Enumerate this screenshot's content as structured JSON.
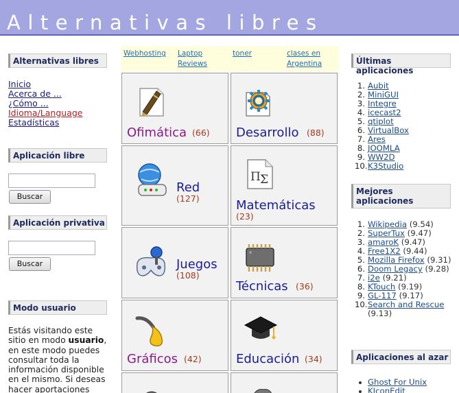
{
  "header": {
    "title": "Alternativas libres"
  },
  "left": {
    "nav_header": "Alternativas libres",
    "nav": [
      "Inicio",
      "Acerca de ...",
      "¿Cómo ...",
      "Idioma/Language",
      "Estadísticas"
    ],
    "free_app": {
      "header": "Aplicación libre",
      "input_value": "",
      "button": "Buscar"
    },
    "priv_app": {
      "header": "Aplicación privativa",
      "input_value": "",
      "button": "Buscar"
    },
    "mode": {
      "header": "Modo usuario",
      "text_before": "Estás visitando este sitio en modo ",
      "text_bold": "usuario",
      "text_after": ", en este modo puedes consultar toda la información disponible en el mismo. Si deseas hacer aportaciones"
    }
  },
  "ads": [
    "Webhosting",
    "Laptop Reviews",
    "toner",
    "clases en Argentina"
  ],
  "categories": [
    {
      "name": "Ofimática",
      "count": "(66)",
      "icon": "pen-document-icon",
      "color": "#8b1a8b"
    },
    {
      "name": "Desarrollo",
      "count": "(88)",
      "icon": "gear-document-icon",
      "color": "#1a1a9c"
    },
    {
      "name": "Red",
      "count": "(127)",
      "icon": "network-router-icon",
      "color": "#1a1a9c"
    },
    {
      "name": "Matemáticas",
      "count": "(23)",
      "icon": "math-formula-icon",
      "color": "#1a1a9c"
    },
    {
      "name": "Juegos",
      "count": "(108)",
      "icon": "gamepad-icon",
      "color": "#1a1a9c"
    },
    {
      "name": "Técnicas",
      "count": "(36)",
      "icon": "microchip-icon",
      "color": "#1a1a9c"
    },
    {
      "name": "Gráficos",
      "count": "(42)",
      "icon": "paintbrush-icon",
      "color": "#8b1a8b"
    },
    {
      "name": "Educación",
      "count": "(34)",
      "icon": "graduation-cap-icon",
      "color": "#1a1a9c"
    }
  ],
  "right": {
    "latest": {
      "header": "Últimas aplicaciones",
      "items": [
        "Aubit",
        "MiniGUI",
        "Integre",
        "icecast2",
        "qtiplot",
        "VirtualBox",
        "Ares",
        "JOOMLA",
        "WW2D",
        "K3Studio"
      ]
    },
    "best": {
      "header": "Mejores aplicaciones",
      "items": [
        {
          "name": "Wikipedia",
          "score": "(9.54)"
        },
        {
          "name": "SuperTux",
          "score": "(9.47)"
        },
        {
          "name": "amaroK",
          "score": "(9.47)"
        },
        {
          "name": "Free1X2",
          "score": "(9.44)"
        },
        {
          "name": "Mozilla Firefox",
          "score": "(9.31)"
        },
        {
          "name": "Doom Legacy",
          "score": "(9.28)"
        },
        {
          "name": "i2e",
          "score": "(9.21)"
        },
        {
          "name": "KTouch",
          "score": "(9.19)"
        },
        {
          "name": "GL-117",
          "score": "(9.17)"
        },
        {
          "name": "Search and Rescue",
          "score": "(9.13)"
        }
      ]
    },
    "random": {
      "header": "Aplicaciones al azar",
      "items": [
        "Ghost For Unix",
        "KIconEdit"
      ]
    }
  }
}
